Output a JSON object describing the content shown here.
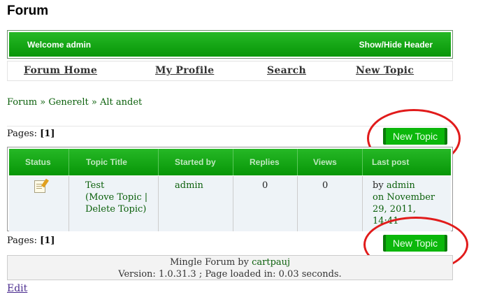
{
  "page": {
    "title": "Forum"
  },
  "header": {
    "welcome": "Welcome admin",
    "toggle_label": "Show/Hide Header"
  },
  "nav": {
    "items": [
      "Forum Home",
      "My Profile",
      "Search",
      "New Topic"
    ]
  },
  "breadcrumb": {
    "items": [
      "Forum",
      "Generelt",
      "Alt andet"
    ],
    "separator": "»"
  },
  "pagination": {
    "label": "Pages:",
    "current": "[1]"
  },
  "buttons": {
    "new_topic": "New Topic"
  },
  "table": {
    "headers": [
      "Status",
      "Topic Title",
      "Started by",
      "Replies",
      "Views",
      "Last post"
    ],
    "rows": [
      {
        "status_icon": "topic-note-icon",
        "title": "Test",
        "move_label": "(Move Topic |",
        "delete_label": "Delete Topic)",
        "started_by": "admin",
        "replies": "0",
        "views": "0",
        "last_post_prefix": "by",
        "last_post_user": "admin",
        "last_post_on": "on",
        "last_post_date_1": "November",
        "last_post_date_2": "29, 2011,",
        "last_post_date_3": "14:41"
      }
    ]
  },
  "footer": {
    "credit_prefix": "Mingle Forum by",
    "credit_author": "cartpauj",
    "version_line": "Version: 1.0.31.3 ; Page loaded in: 0.03 seconds."
  },
  "edit_link": "Edit",
  "colors": {
    "accent_green": "#079607",
    "annotation_red": "#e11b1b",
    "link_green": "#0a5f0a"
  }
}
